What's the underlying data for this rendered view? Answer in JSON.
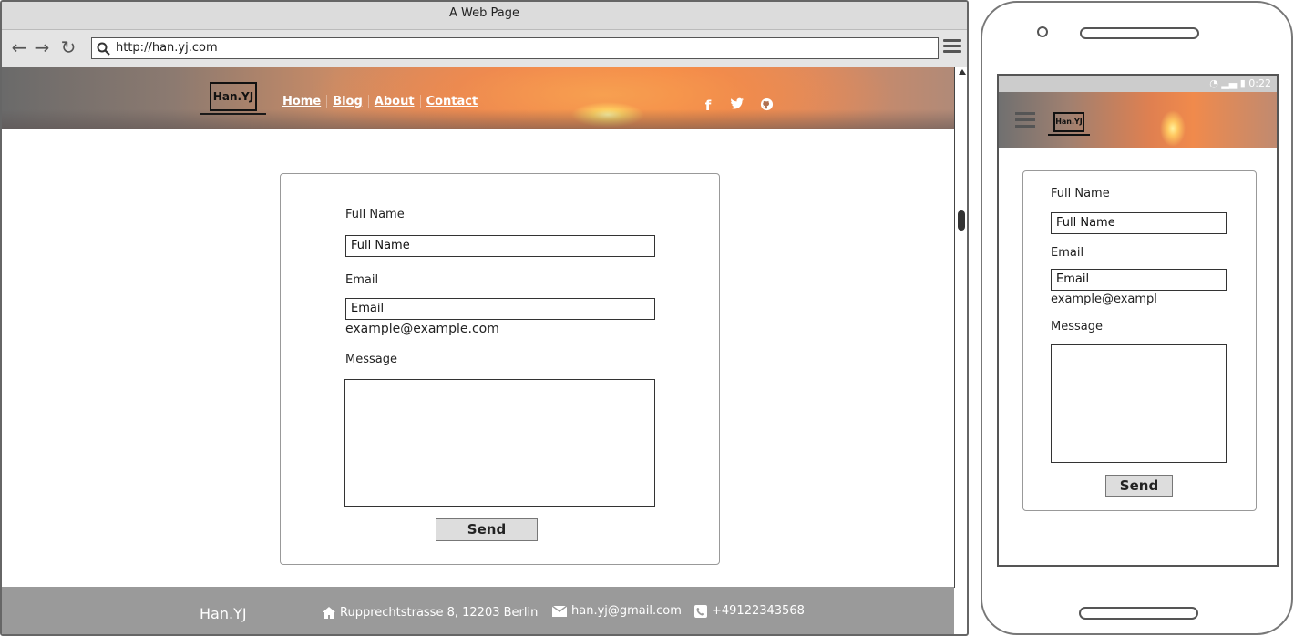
{
  "browser": {
    "title": "A Web Page",
    "url": "http://han.yj.com",
    "back_icon": "←",
    "forward_icon": "→",
    "reload_icon": "↻"
  },
  "site": {
    "logo": "Han.YJ",
    "nav": [
      "Home",
      "Blog",
      "About",
      "Contact"
    ],
    "social": {
      "facebook": "f",
      "twitter": "🐦",
      "github": "◉"
    }
  },
  "form": {
    "name_label": "Full Name",
    "name_placeholder": "Full Name",
    "email_label": "Email",
    "email_placeholder": "Email",
    "email_hint": "example@example.com",
    "message_label": "Message",
    "send_label": "Send"
  },
  "footer": {
    "brand": "Han.YJ",
    "address": "Rupprechtstrasse 8, 12203 Berlin",
    "email": "han.yj@gmail.com",
    "phone": "+49122343568"
  },
  "mobile": {
    "status_time": "0:22",
    "status_icons": "◔ ▂▄ ▮",
    "logo": "Han.YJ",
    "email_hint": "example@exampl"
  }
}
